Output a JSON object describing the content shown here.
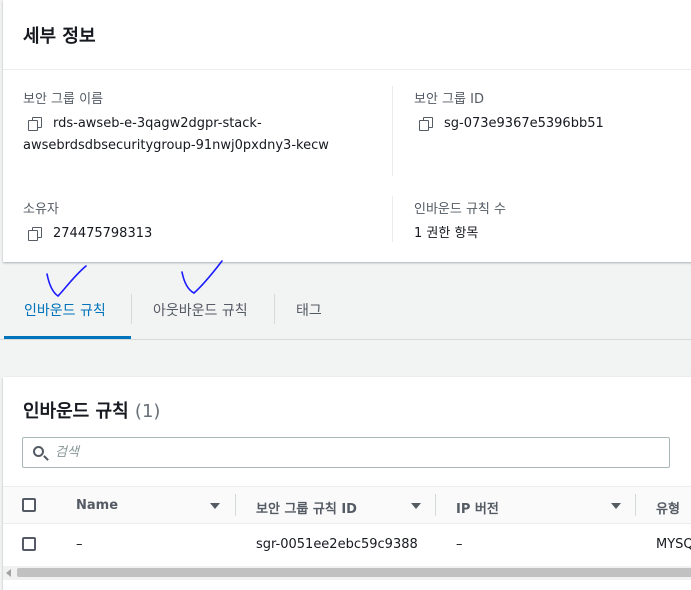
{
  "details": {
    "title": "세부 정보",
    "sg_name_label": "보안 그룹 이름",
    "sg_name_line1": "rds-awseb-e-3qagw2dgpr-stack-",
    "sg_name_line2": "awsebrdsdbsecuritygroup-91nwj0pxdny3-kecw",
    "sg_id_label": "보안 그룹 ID",
    "sg_id_value": "sg-073e9367e5396bb51",
    "owner_label": "소유자",
    "owner_value": "274475798313",
    "inbound_count_label": "인바운드 규칙 수",
    "inbound_count_value": "1 권한 항목"
  },
  "tabs": [
    {
      "label": "인바운드 규칙",
      "active": true
    },
    {
      "label": "아웃바운드 규칙",
      "active": false
    },
    {
      "label": "태그",
      "active": false
    }
  ],
  "rules": {
    "title": "인바운드 규칙",
    "count": "(1)",
    "search_placeholder": "검색",
    "columns": [
      "Name",
      "보안 그룹 규칙 ID",
      "IP 버전",
      "유형"
    ],
    "rows": [
      {
        "name": "–",
        "rule_id": "sgr-0051ee2ebc59c9388",
        "ip_version": "–",
        "type": "MYSQ"
      }
    ]
  },
  "colors": {
    "accent": "#0073bb",
    "annotation": "#1a1aff"
  }
}
